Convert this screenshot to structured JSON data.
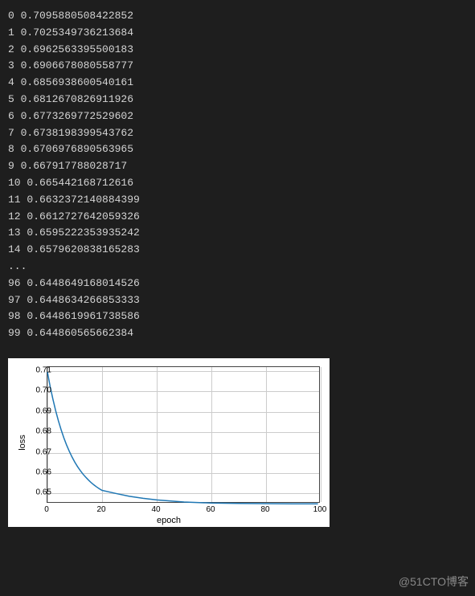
{
  "console_lines": [
    {
      "idx": "0",
      "val": "0.7095880508422852"
    },
    {
      "idx": "1",
      "val": "0.7025349736213684"
    },
    {
      "idx": "2",
      "val": "0.6962563395500183"
    },
    {
      "idx": "3",
      "val": "0.6906678080558777"
    },
    {
      "idx": "4",
      "val": "0.6856938600540161"
    },
    {
      "idx": "5",
      "val": "0.6812670826911926"
    },
    {
      "idx": "6",
      "val": "0.6773269772529602"
    },
    {
      "idx": "7",
      "val": "0.6738198399543762"
    },
    {
      "idx": "8",
      "val": "0.6706976890563965"
    },
    {
      "idx": "9",
      "val": "0.667917788028717"
    },
    {
      "idx": "10",
      "val": "0.665442168712616"
    },
    {
      "idx": "11",
      "val": "0.6632372140884399"
    },
    {
      "idx": "12",
      "val": "0.6612727642059326"
    },
    {
      "idx": "13",
      "val": "0.6595222353935242"
    },
    {
      "idx": "14",
      "val": "0.6579620838165283"
    }
  ],
  "ellipsis": "...",
  "console_lines_tail": [
    {
      "idx": "96",
      "val": "0.6448649168014526"
    },
    {
      "idx": "97",
      "val": "0.6448634266853333"
    },
    {
      "idx": "98",
      "val": "0.6448619961738586"
    },
    {
      "idx": "99",
      "val": "0.644860565662384"
    }
  ],
  "chart_data": {
    "type": "line",
    "title": "",
    "xlabel": "epoch",
    "ylabel": "loss",
    "xlim": [
      0,
      100
    ],
    "ylim": [
      0.645,
      0.712
    ],
    "xticks": [
      0,
      20,
      40,
      60,
      80,
      100
    ],
    "yticks": [
      0.65,
      0.66,
      0.67,
      0.68,
      0.69,
      0.7,
      0.71
    ],
    "series": [
      {
        "name": "loss",
        "color": "#1f77b4",
        "x": [
          0,
          1,
          2,
          3,
          4,
          5,
          6,
          7,
          8,
          9,
          10,
          11,
          12,
          13,
          14,
          15,
          16,
          17,
          18,
          19,
          20,
          25,
          30,
          35,
          40,
          50,
          60,
          70,
          80,
          90,
          96,
          97,
          98,
          99
        ],
        "y": [
          0.7096,
          0.7025,
          0.6963,
          0.6907,
          0.6857,
          0.6813,
          0.6773,
          0.6738,
          0.6707,
          0.6679,
          0.6654,
          0.6632,
          0.6613,
          0.6595,
          0.658,
          0.6566,
          0.6553,
          0.6542,
          0.6532,
          0.6523,
          0.6515,
          0.65,
          0.6486,
          0.6476,
          0.6468,
          0.6458,
          0.6453,
          0.6451,
          0.645,
          0.6449,
          0.6449,
          0.6449,
          0.6449,
          0.6449
        ]
      }
    ]
  },
  "watermark": "@51CTO博客"
}
